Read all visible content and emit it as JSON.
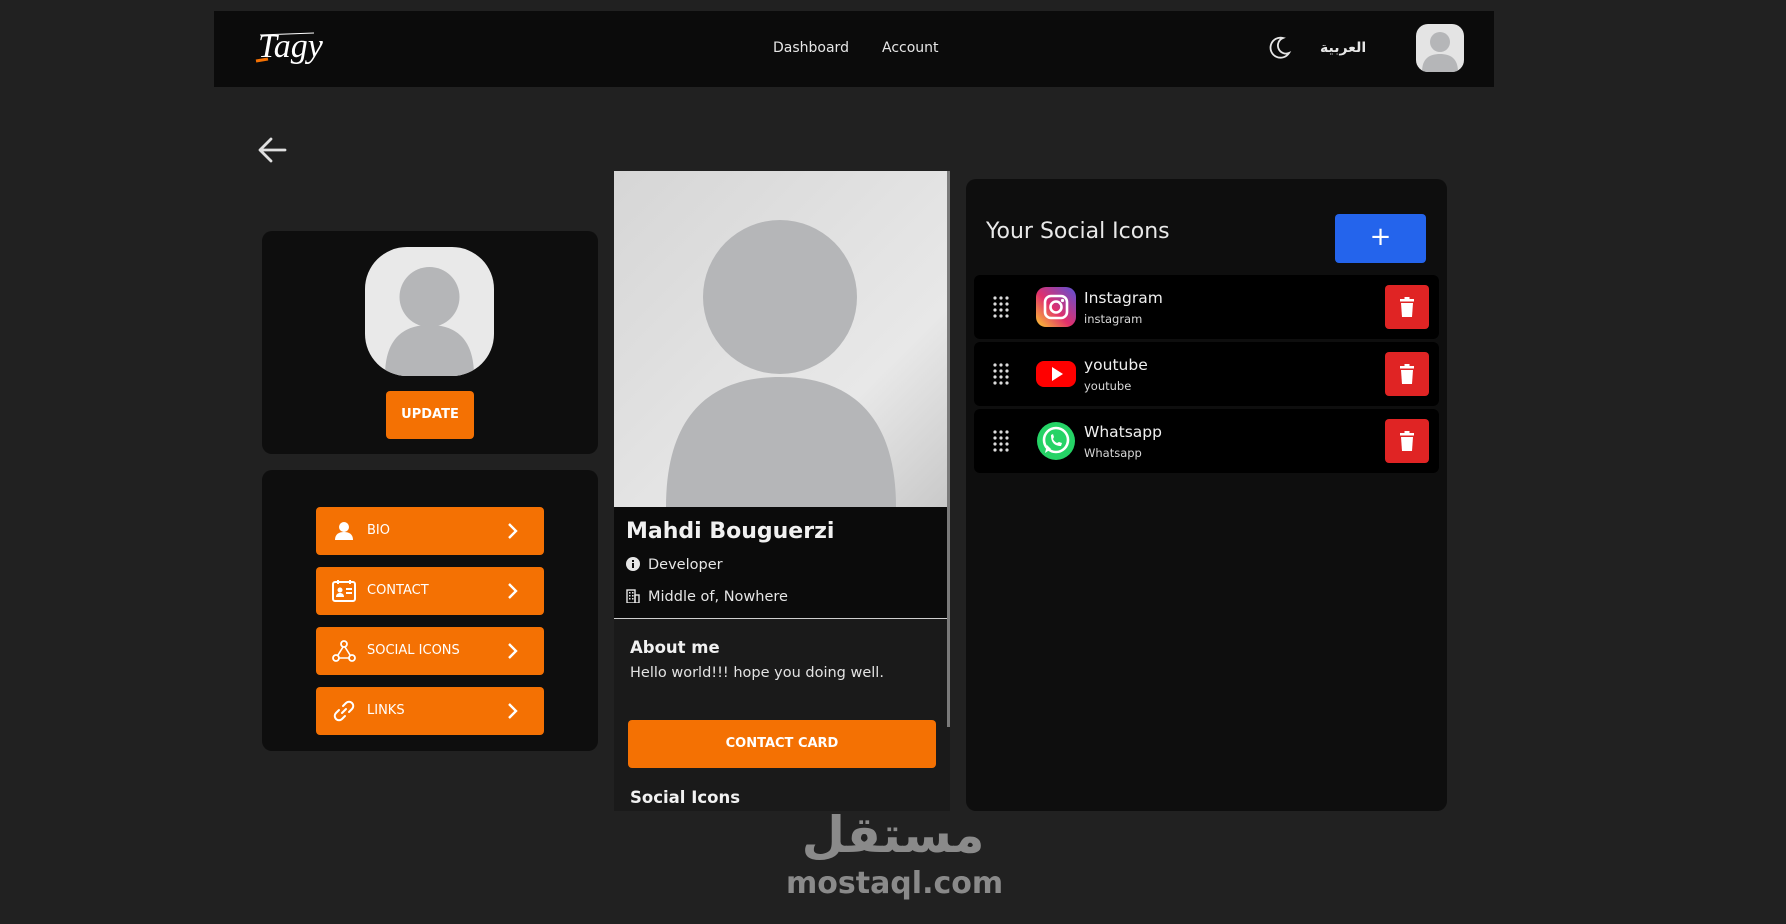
{
  "navbar": {
    "logo_text": "Tagy",
    "links": [
      "Dashboard",
      "Account"
    ],
    "language": "العربية",
    "theme_icon": "moon-icon",
    "avatar_icon": "user-avatar-icon"
  },
  "back_icon": "arrow-left-icon",
  "profile_photo": {
    "update_label": "UPDATE"
  },
  "menu": {
    "items": [
      {
        "label": "BIO",
        "icon": "user-icon"
      },
      {
        "label": "CONTACT",
        "icon": "contact-card-icon"
      },
      {
        "label": "SOCIAL ICONS",
        "icon": "share-nodes-icon"
      },
      {
        "label": "LINKS",
        "icon": "link-icon"
      }
    ]
  },
  "preview": {
    "name": "Mahdi Bouguerzi",
    "job": "Developer",
    "location": "Middle of, Nowhere",
    "about_title": "About me",
    "about_text": "Hello world!!! hope you doing well.",
    "contact_card_label": "CONTACT CARD",
    "social_title": "Social Icons"
  },
  "social_panel": {
    "heading": "Your Social Icons",
    "add_label": "+",
    "items": [
      {
        "name": "Instagram",
        "handle": "instagram",
        "icon": "instagram-icon"
      },
      {
        "name": "youtube",
        "handle": "youtube",
        "icon": "youtube-icon"
      },
      {
        "name": "Whatsapp",
        "handle": "Whatsapp",
        "icon": "whatsapp-icon"
      }
    ]
  },
  "watermark": {
    "arabic": "مستقل",
    "latin": "mostaql.com"
  },
  "colors": {
    "background": "#212121",
    "panel": "#0e0e0e",
    "accent_orange": "#f47103",
    "add_blue": "#2464ec",
    "delete_red": "#e02424"
  }
}
